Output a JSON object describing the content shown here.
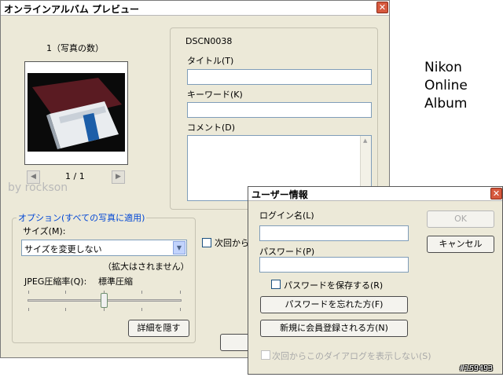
{
  "main_window": {
    "title": "オンラインアルバム プレビュー",
    "close_glyph": "✕",
    "photo_count_label": "1（写真の数）",
    "pager": {
      "prev": "◀",
      "text": "1 / 1",
      "next": "▶"
    },
    "watermark": "by rockson",
    "file_name": "DSCN0038",
    "title_label": "タイトル(T)",
    "keyword_label": "キーワード(K)",
    "comment_label": "コメント(D)",
    "scroll_up": "▲",
    "scroll_down": "▼",
    "options_group_title": "オプション(すべての写真に適用)",
    "size_label": "サイズ(M):",
    "size_select_value": "サイズを変更しない",
    "size_select_arrow": "▼",
    "size_note": "（拡大はされません）",
    "jpeg_label": "JPEG圧縮率(Q):",
    "jpeg_value": "標準圧縮",
    "details_button": "詳細を隠す",
    "next_time_checkbox_label": "次回から"
  },
  "brand": {
    "line1": "Nikon",
    "line2": "Online",
    "line3": "Album"
  },
  "user_dialog": {
    "title": "ユーザー情報",
    "close_glyph": "✕",
    "login_label": "ログイン名(L)",
    "password_label": "パスワード(P)",
    "save_password_label": "パスワードを保存する(R)",
    "forgot_password_button": "パスワードを忘れた方(F)",
    "new_register_button": "新規に会員登録される方(N)",
    "dont_show_label": "次回からこのダイアログを表示しない(S)",
    "ok_button": "OK",
    "cancel_button": "キャンセル"
  },
  "footer_id": "#159493"
}
